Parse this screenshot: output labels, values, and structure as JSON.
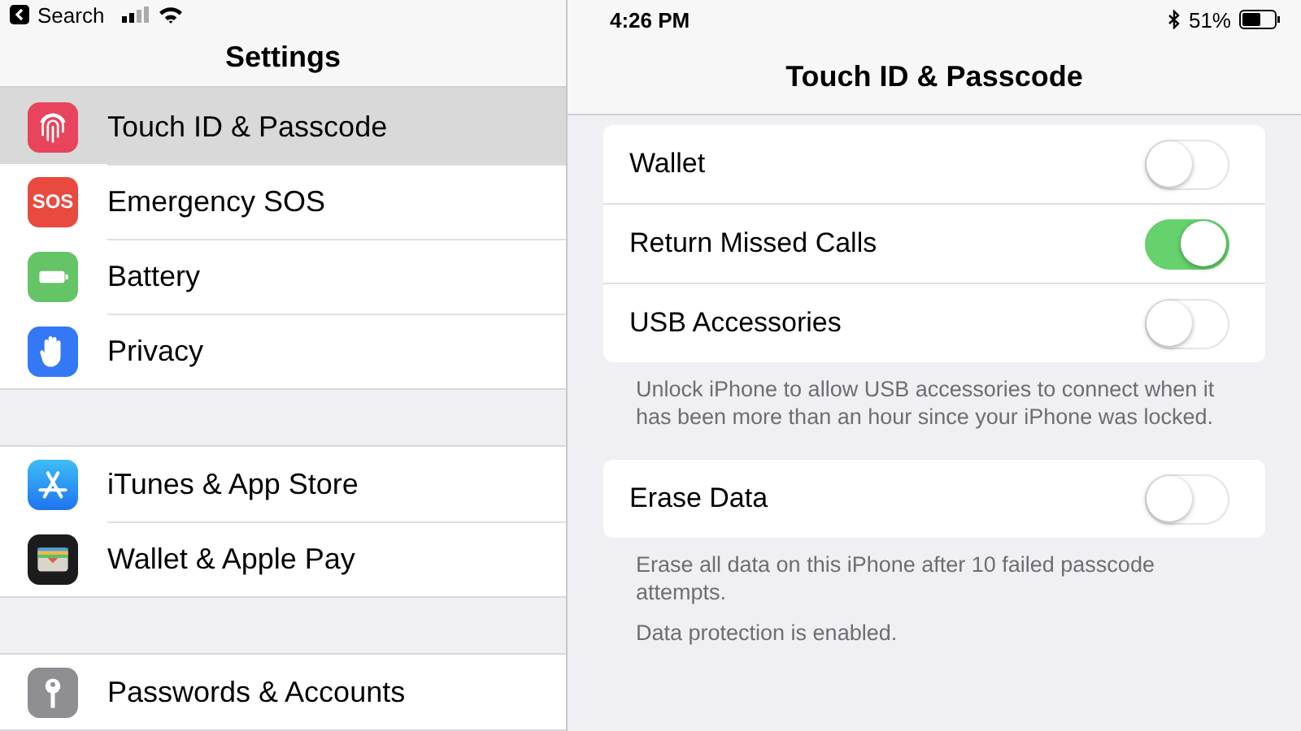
{
  "status_bar": {
    "back_label": "Search",
    "time": "4:26 PM",
    "battery": "51%"
  },
  "sidebar": {
    "title": "Settings",
    "groups": [
      [
        {
          "label": "Touch ID & Passcode",
          "selected": true
        },
        {
          "label": "Emergency SOS",
          "selected": false,
          "badge": "SOS"
        },
        {
          "label": "Battery",
          "selected": false
        },
        {
          "label": "Privacy",
          "selected": false
        }
      ],
      [
        {
          "label": "iTunes & App Store",
          "selected": false
        },
        {
          "label": "Wallet & Apple Pay",
          "selected": false
        }
      ],
      [
        {
          "label": "Passwords & Accounts",
          "selected": false
        }
      ]
    ]
  },
  "detail": {
    "title": "Touch ID & Passcode",
    "sections": [
      {
        "rows": [
          {
            "label": "Wallet",
            "on": false
          },
          {
            "label": "Return Missed Calls",
            "on": true
          },
          {
            "label": "USB Accessories",
            "on": false
          }
        ],
        "footer": [
          "Unlock iPhone to allow USB accessories to connect when it has been more than an hour since your iPhone was locked."
        ]
      },
      {
        "rows": [
          {
            "label": "Erase Data",
            "on": false
          }
        ],
        "footer": [
          "Erase all data on this iPhone after 10 failed passcode attempts.",
          "Data protection is enabled."
        ]
      }
    ]
  }
}
